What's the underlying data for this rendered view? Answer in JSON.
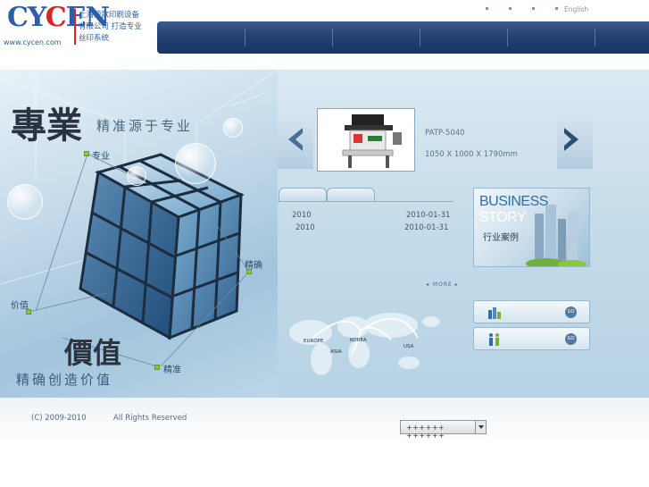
{
  "header": {
    "logo_text": "CYCEN",
    "logo_url": "www.cycen.com",
    "company_cn": "上海荣歆印刷设备有限公司 打造专业丝印系统",
    "lang_link": "English",
    "nav_dots": 4,
    "nav_sections": 7
  },
  "hero": {
    "slogan_a": "專業",
    "slogan_a_sub": "精准源于专业",
    "slogan_b": "價值",
    "slogan_b_sub": "精确创造价值",
    "tags": {
      "professional": "专业",
      "precise": "精确",
      "value": "价值",
      "accurate": "精准"
    }
  },
  "product": {
    "name": "PATP-5040",
    "size": "1050 X 1000 X 1790mm"
  },
  "news": {
    "items": [
      {
        "title": "2010",
        "date": "2010-01-31"
      },
      {
        "title": "2010",
        "date": "2010-01-31"
      }
    ],
    "more": "MORE"
  },
  "business": {
    "title_line1": "BUSINESS",
    "title_line2": "STORY",
    "subtitle_cn": "行业案例"
  },
  "side_buttons": {
    "go_label": "GO"
  },
  "map": {
    "labels": [
      "EUROPE",
      "KOREA",
      "ASIA",
      "USA"
    ]
  },
  "footer": {
    "copyright": "(C) 2009-2010",
    "rights": "All Rights Reserved",
    "select_value": "++++++   ++++++"
  },
  "colors": {
    "nav_bg": "#1f3d6e",
    "accent_green": "#8cc63f",
    "brand_blue": "#2b5fa8",
    "brand_red": "#dd2222"
  }
}
